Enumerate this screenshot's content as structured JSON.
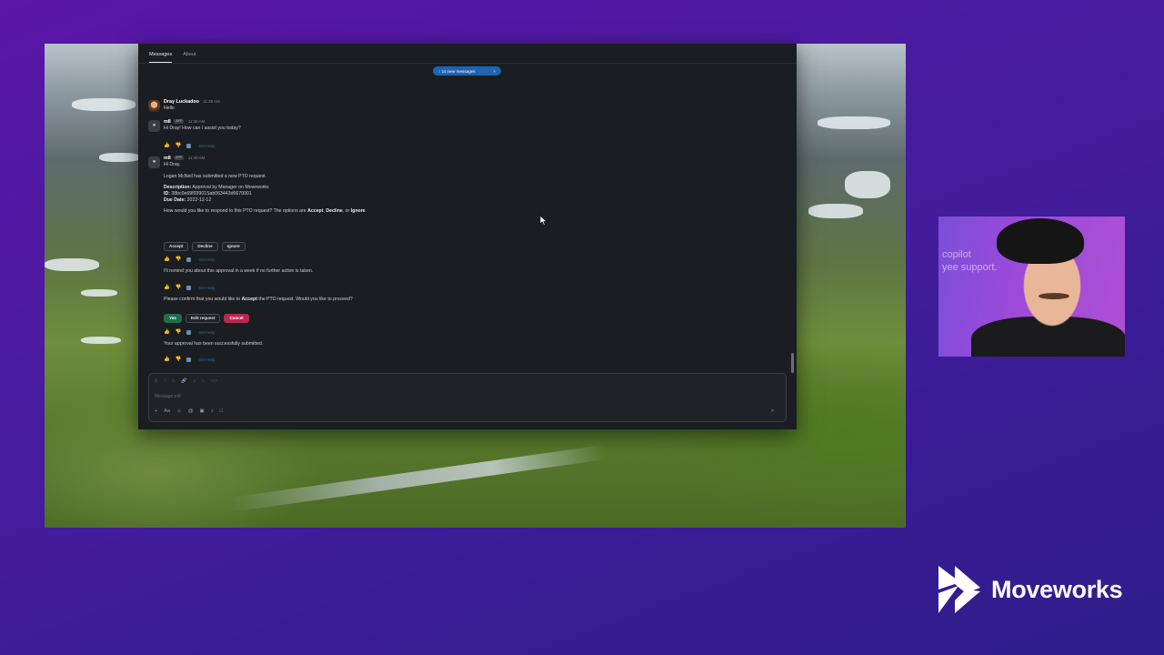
{
  "app": {
    "tabs": [
      {
        "label": "Messages",
        "active": true
      },
      {
        "label": "About",
        "active": false
      }
    ],
    "new_messages_pill": "↑ 14 new messages",
    "new_messages_close": "×"
  },
  "messages": [
    {
      "sender": "Dray Luckadoo",
      "badge": "",
      "time": "11:38 AM",
      "lines": [
        "Hello"
      ]
    },
    {
      "sender": "m8",
      "badge": "APP",
      "time": "11:38 AM",
      "lines": [
        "Hi Dray! How can I assist you today?"
      ]
    },
    {
      "sender": "m8",
      "badge": "APP",
      "time": "11:40 AM",
      "greeting": "Hi Dray,",
      "intro": "Logan McNeil has submitted a new PTO request.",
      "description_label": "Description:",
      "description_value": "Approval by Manager on Moveworks",
      "id_label": "ID:",
      "id_value": "38bc0e69f93901Sab063443d6670001",
      "due_label": "Due Date:",
      "due_value": "2022-12-12",
      "question_pre": "How would you like to respond to this PTO request? The options are ",
      "question_accept": "Accept",
      "question_sep1": ", ",
      "question_decline": "Decline",
      "question_sep2": ", or ",
      "question_ignore": "Ignore",
      "question_end": "."
    }
  ],
  "pto_buttons": {
    "accept": "Accept",
    "decline": "Decline",
    "ignore": "Ignore"
  },
  "reminder_text": "I'll remind you about this approval in a week if no further action is taken.",
  "confirm_pre": "Please confirm that you would like to ",
  "confirm_bold": "Accept",
  "confirm_post": " the PTO request. Would you like to proceed?",
  "confirm_buttons": {
    "yes": "Yes",
    "edit": "Edit request",
    "cancel": "Cancel"
  },
  "submitted_text": "Your approval has been successfully submitted.",
  "get_help": "Get Help",
  "composer": {
    "placeholder": "Message m8",
    "send_icon": "➤"
  },
  "webcam": {
    "background_text_line1": "copilot",
    "background_text_line2": "yee support."
  },
  "brand": {
    "name": "Moveworks",
    "color": "#ffffff"
  },
  "colors": {
    "accent": "#1d64b3",
    "yes": "#1f6e4b",
    "cancel": "#b8284f",
    "link": "#3c8fd8"
  }
}
